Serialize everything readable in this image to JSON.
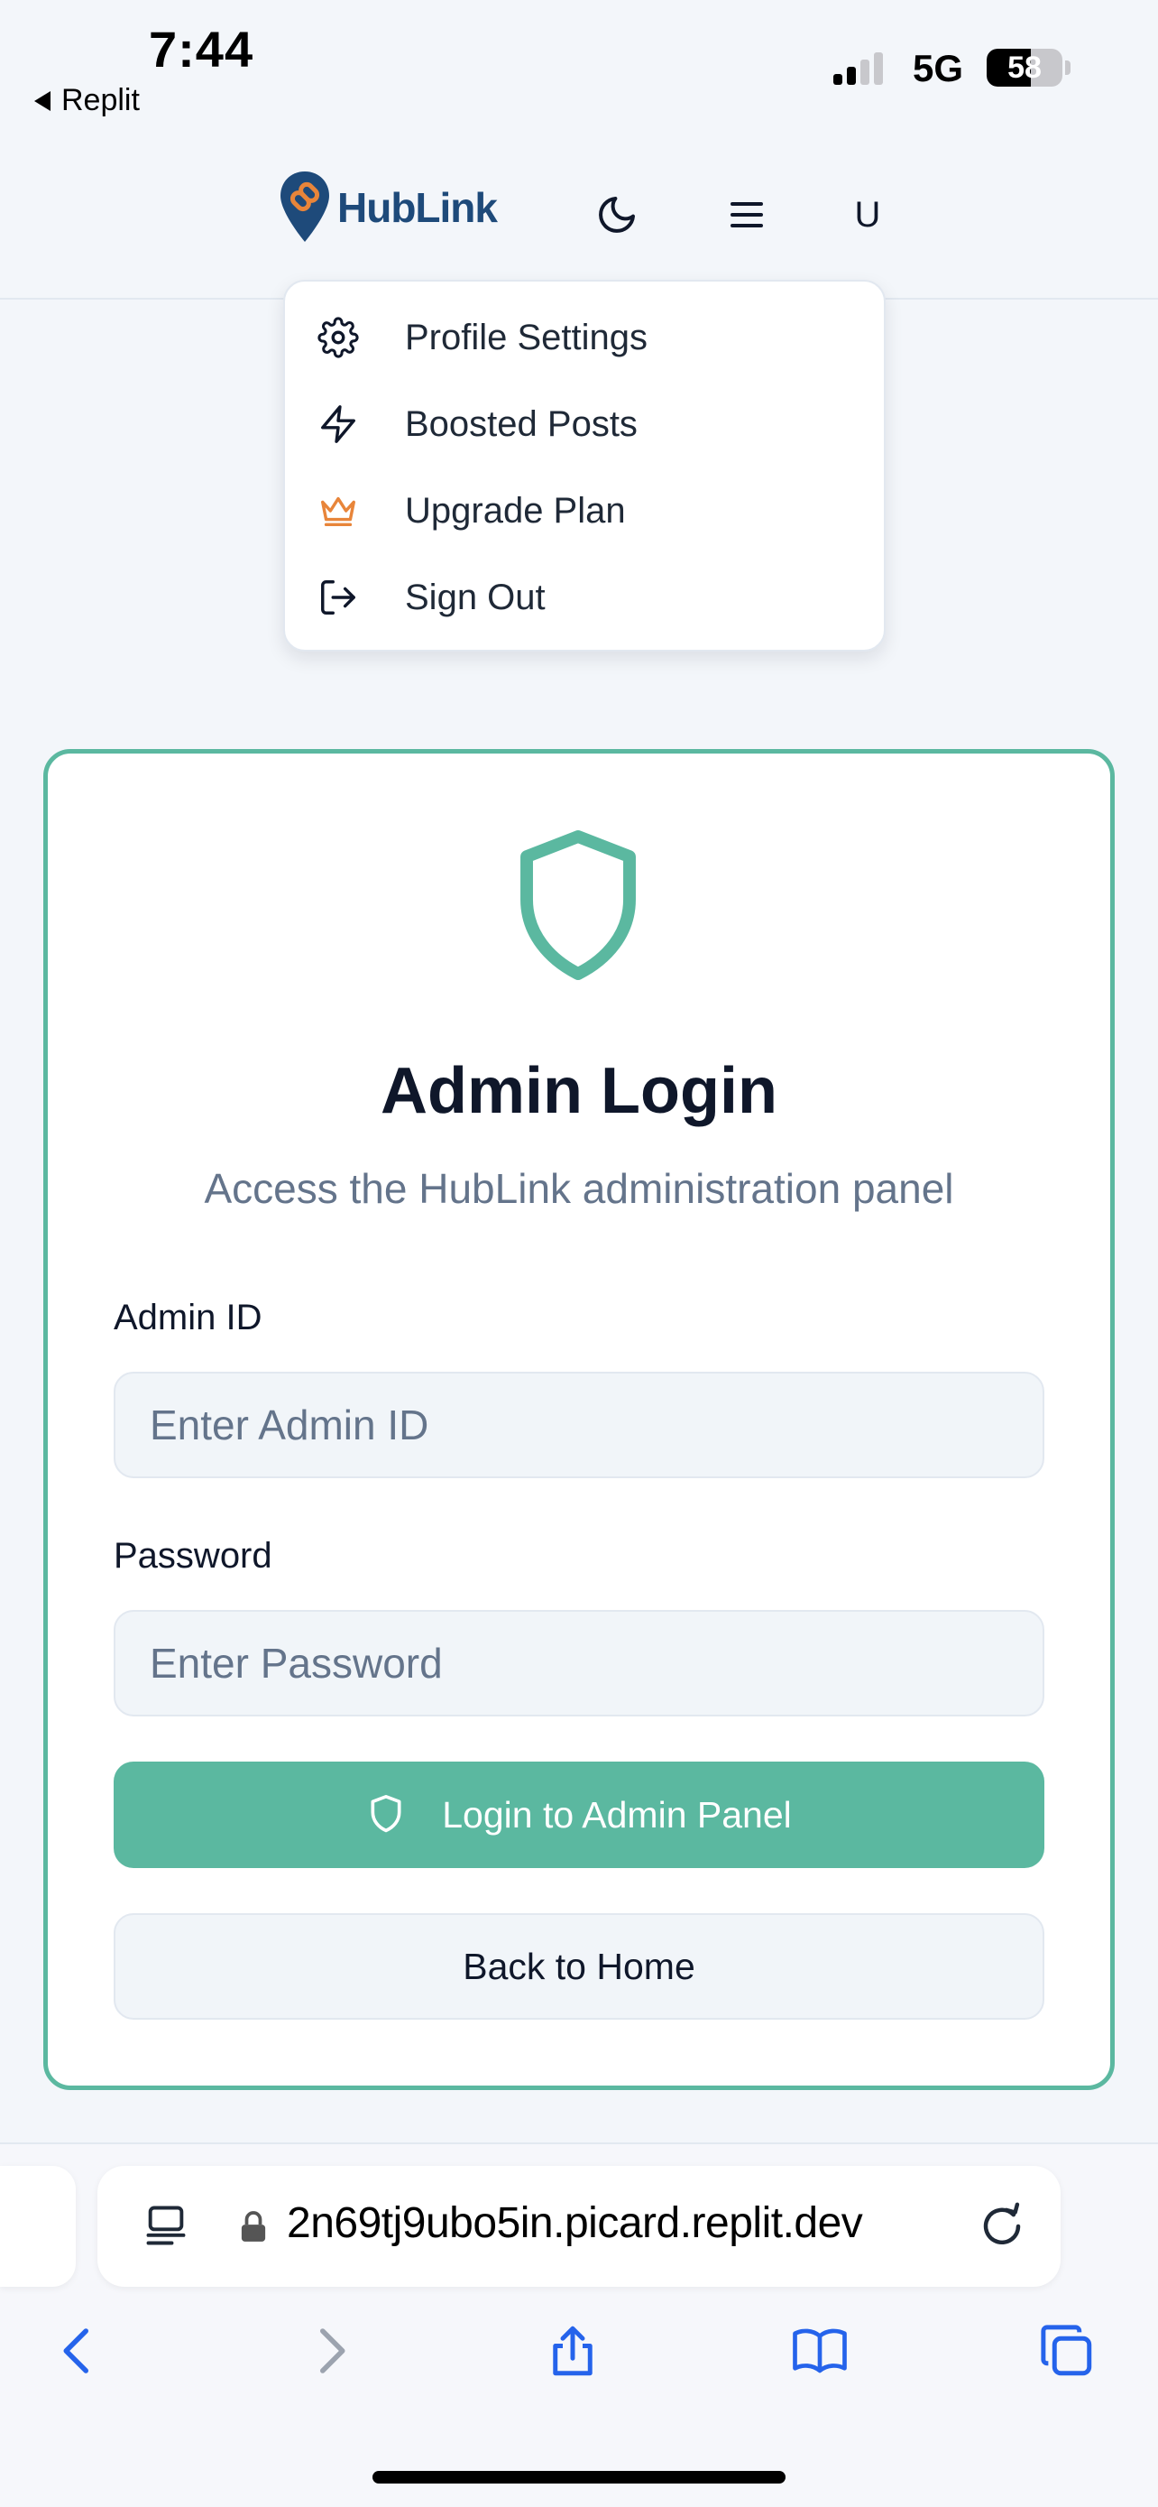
{
  "status_bar": {
    "time": "7:44",
    "back_app": "Replit",
    "network": "5G",
    "battery": "58",
    "battery_fraction": 0.58
  },
  "header": {
    "logo_text": "HubLink",
    "theme_icon": "moon-icon",
    "menu_icon": "hamburger-icon",
    "user_initial": "U"
  },
  "dropdown": {
    "items": [
      {
        "label": "Profile Settings",
        "icon": "gear-icon"
      },
      {
        "label": "Boosted Posts",
        "icon": "lightning-icon"
      },
      {
        "label": "Upgrade Plan",
        "icon": "crown-icon"
      },
      {
        "label": "Sign Out",
        "icon": "logout-icon"
      }
    ]
  },
  "login_card": {
    "title": "Admin Login",
    "subtitle": "Access the HubLink administration panel",
    "admin_id_label": "Admin ID",
    "admin_id_placeholder": "Enter Admin ID",
    "admin_id_value": "",
    "password_label": "Password",
    "password_placeholder": "Enter Password",
    "password_value": "",
    "login_button": "Login to Admin Panel",
    "back_button": "Back to Home"
  },
  "browser": {
    "url": "2n69tj9ubo5in.picard.replit.dev"
  },
  "colors": {
    "accent": "#5bb8a0",
    "brand_blue": "#1e4a7a",
    "brand_orange": "#e8853a",
    "crown": "#e8853a"
  }
}
